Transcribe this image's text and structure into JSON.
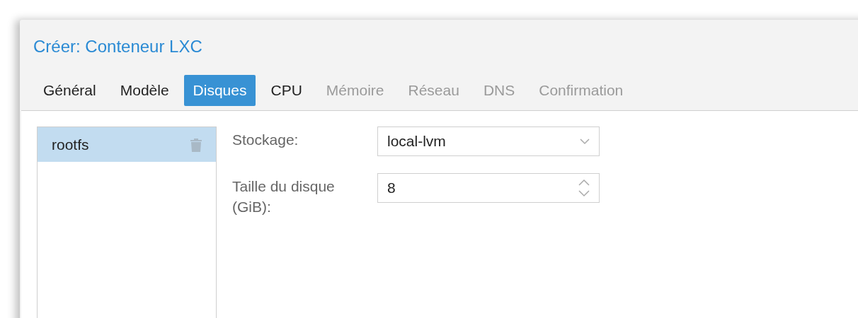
{
  "window": {
    "title": "Créer: Conteneur LXC"
  },
  "tabs": [
    {
      "label": "Général",
      "selected": false,
      "disabled": false
    },
    {
      "label": "Modèle",
      "selected": false,
      "disabled": false
    },
    {
      "label": "Disques",
      "selected": true,
      "disabled": false
    },
    {
      "label": "CPU",
      "selected": false,
      "disabled": false
    },
    {
      "label": "Mémoire",
      "selected": false,
      "disabled": true
    },
    {
      "label": "Réseau",
      "selected": false,
      "disabled": true
    },
    {
      "label": "DNS",
      "selected": false,
      "disabled": true
    },
    {
      "label": "Confirmation",
      "selected": false,
      "disabled": true
    }
  ],
  "disks": [
    {
      "name": "rootfs",
      "selected": true
    }
  ],
  "fields": [
    {
      "kind": "combo",
      "label": "Stockage:",
      "value": "local-lvm"
    },
    {
      "kind": "spinner",
      "label": "Taille du disque (GiB):",
      "value": "8"
    }
  ]
}
